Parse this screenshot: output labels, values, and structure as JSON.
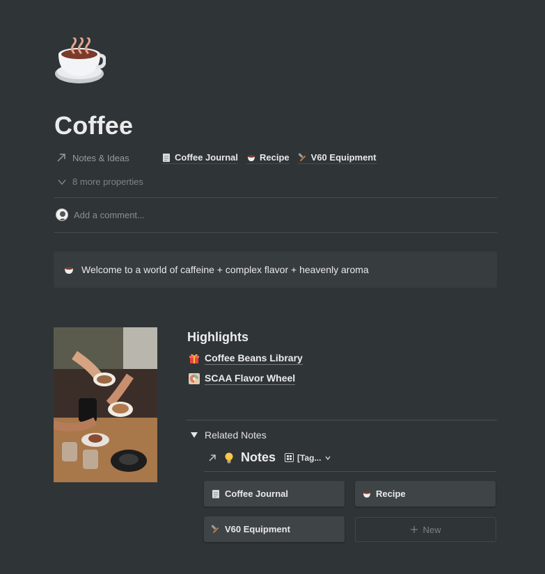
{
  "page": {
    "title": "Coffee",
    "icon": "hot-beverage-icon"
  },
  "properties": {
    "relation_name": "Notes & Ideas",
    "relations": [
      {
        "label": "Coffee Journal",
        "icon": "page-icon"
      },
      {
        "label": "Recipe",
        "icon": "coffee-cup-icon"
      },
      {
        "label": "V60 Equipment",
        "icon": "hammer-icon"
      }
    ],
    "more_properties": "8 more properties"
  },
  "comment": {
    "placeholder": "Add a comment..."
  },
  "callout": {
    "icon": "coffee-cup-icon",
    "text": "Welcome to a world of caffeine + complex flavor + heavenly aroma"
  },
  "highlights": {
    "title": "Highlights",
    "links": [
      {
        "label": "Coffee Beans Library",
        "icon": "gift-icon"
      },
      {
        "label": "SCAA Flavor Wheel",
        "icon": "wheel-image-icon"
      }
    ]
  },
  "related": {
    "toggle_label": "Related Notes",
    "database": {
      "title": "Notes",
      "icon": "lightbulb-icon",
      "view_label": "[Tag..."
    },
    "cards": [
      {
        "label": "Coffee Journal",
        "icon": "page-icon"
      },
      {
        "label": "Recipe",
        "icon": "coffee-cup-icon"
      },
      {
        "label": "V60 Equipment",
        "icon": "hammer-icon"
      }
    ],
    "new_label": "New"
  },
  "colors": {
    "background": "#2f3437",
    "callout_bg": "#373c3f",
    "card_bg": "#3f4447",
    "text_primary": "#ebebeb",
    "text_muted": "#9b9b9b"
  }
}
